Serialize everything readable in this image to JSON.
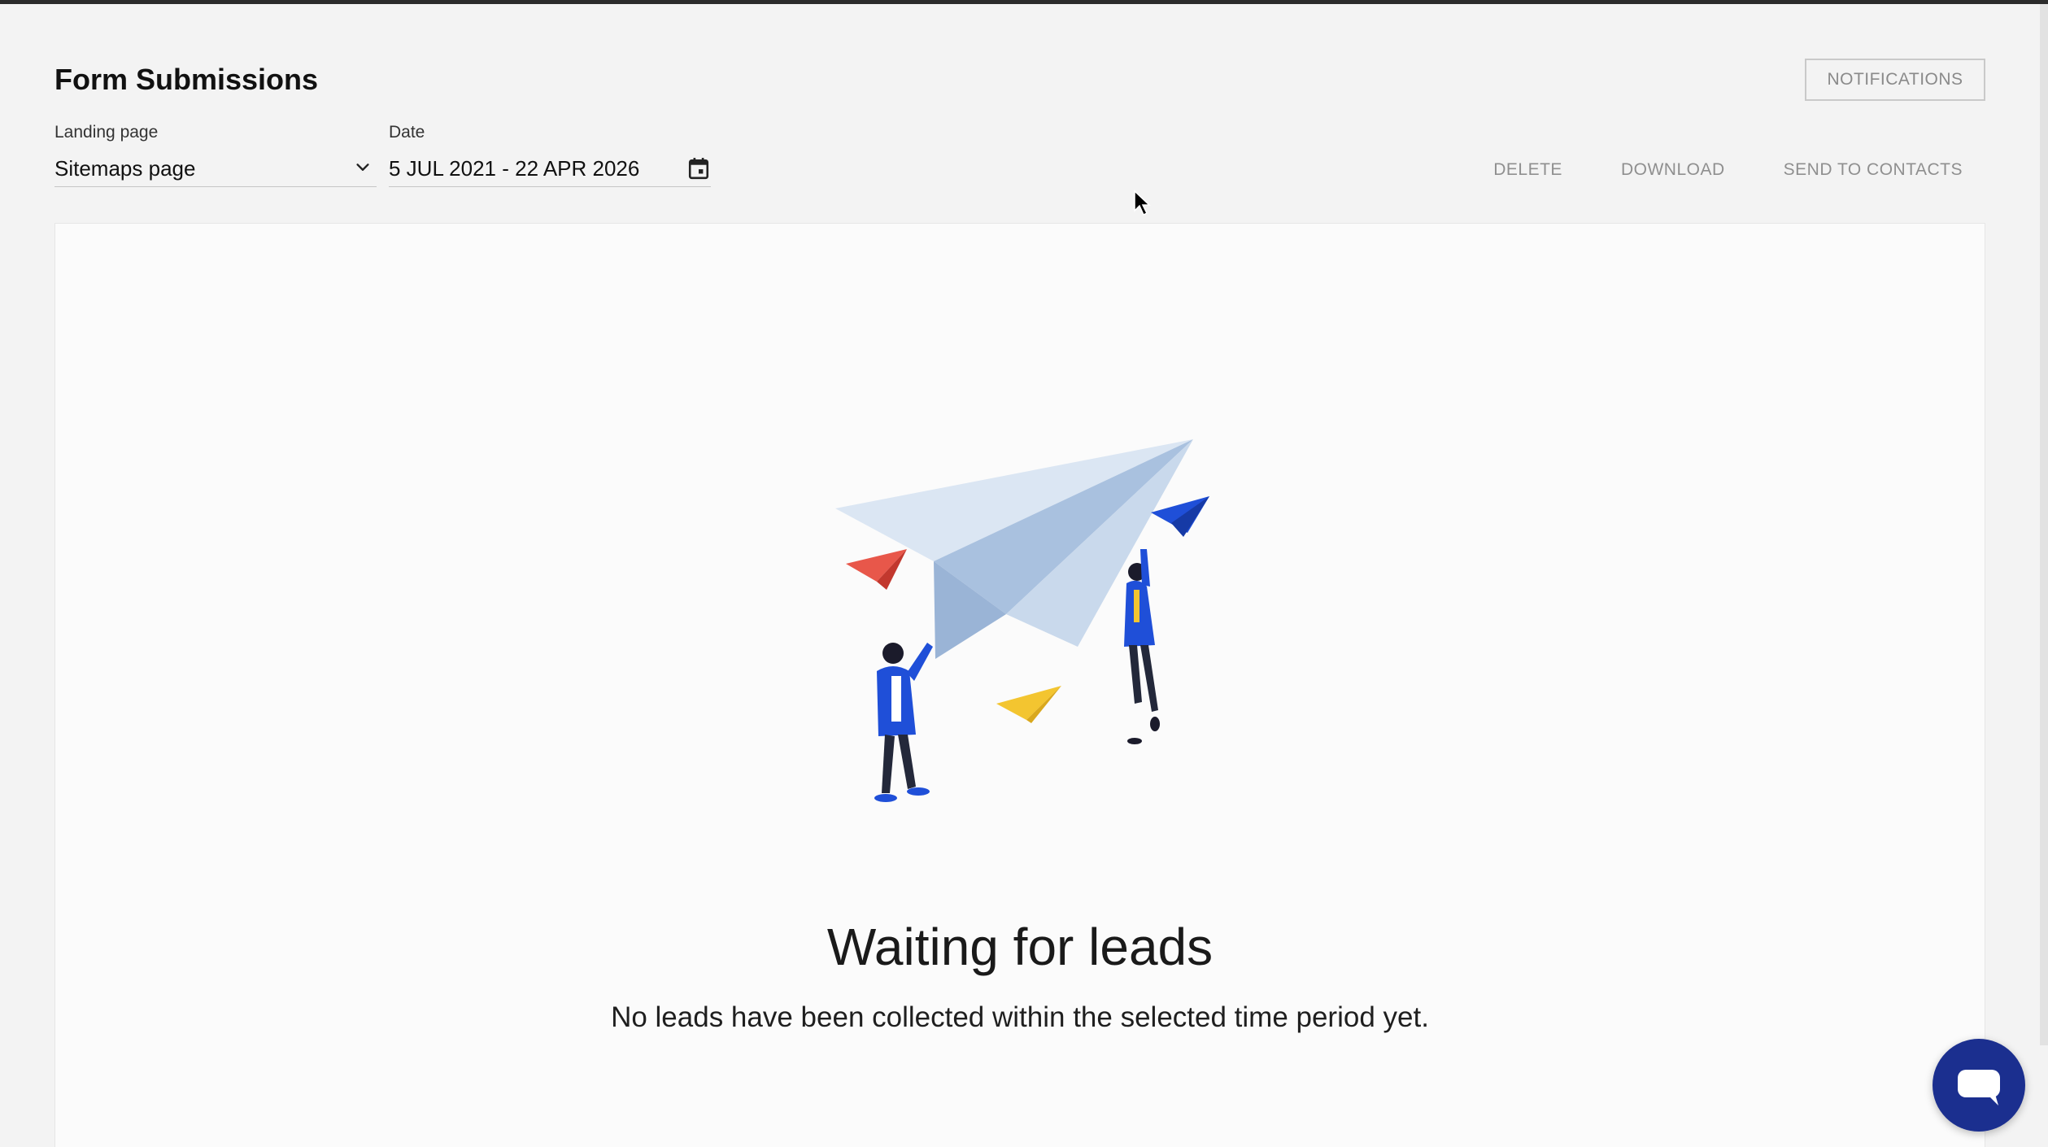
{
  "header": {
    "title": "Form Submissions",
    "notifications_label": "NOTIFICATIONS"
  },
  "filters": {
    "landing_page": {
      "label": "Landing page",
      "value": "Sitemaps page"
    },
    "date": {
      "label": "Date",
      "value": "5 JUL 2021 - 22 APR 2026"
    }
  },
  "actions": {
    "delete_label": "DELETE",
    "download_label": "DOWNLOAD",
    "send_label": "SEND TO CONTACTS"
  },
  "empty_state": {
    "title": "Waiting for leads",
    "subtitle": "No leads have been collected within the selected time period yet."
  },
  "icons": {
    "chevron": "chevron-down-icon",
    "calendar": "calendar-icon",
    "chat": "chat-icon",
    "cursor": "mouse-cursor-icon"
  },
  "colors": {
    "chat_button": "#1b2f8f",
    "accent_blue": "#1f4fd8",
    "paper_plane_red": "#e8574a",
    "paper_plane_yellow": "#f3c530"
  }
}
